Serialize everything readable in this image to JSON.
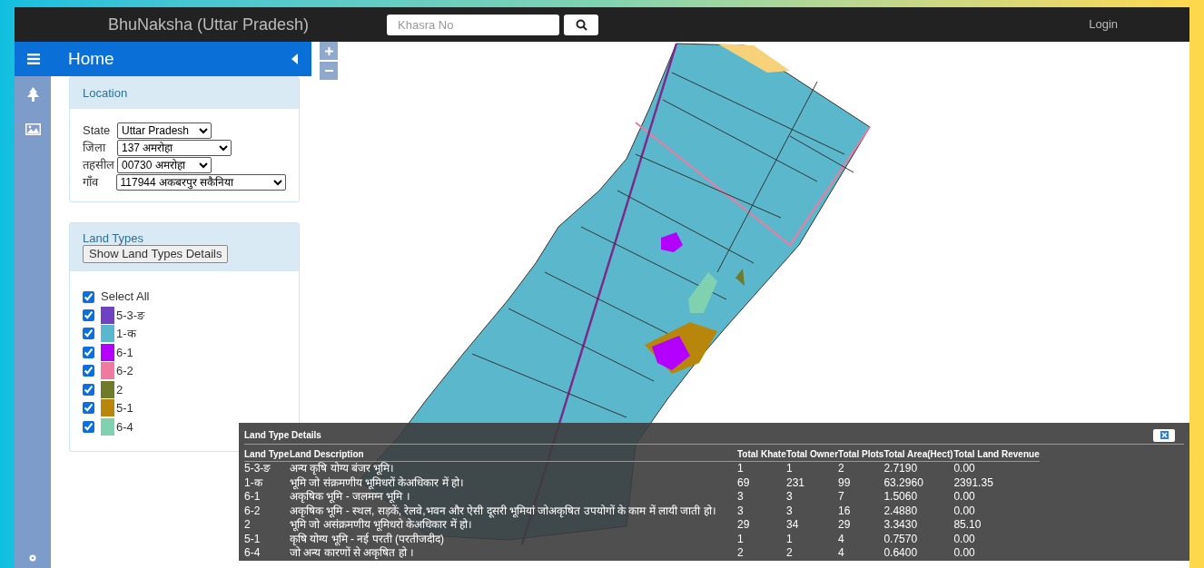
{
  "header": {
    "title": "BhuNaksha (Uttar Pradesh)",
    "search_placeholder": "Khasra No",
    "login": "Login"
  },
  "sidebar": {
    "title": "Home"
  },
  "location": {
    "title": "Location",
    "fields": [
      {
        "label": "State",
        "value": "Uttar Pradesh"
      },
      {
        "label": "जिला",
        "value": "137 अमरोहा"
      },
      {
        "label": "तहसील",
        "value": "00730 अमरोहा"
      },
      {
        "label": "गाँव",
        "value": "117944 अकबरपुर सकैनिया"
      }
    ]
  },
  "land_types": {
    "title": "Land Types",
    "button": "Show Land Types Details",
    "select_all": {
      "label": "Select All",
      "checked": true
    },
    "items": [
      {
        "code": "5-3-ङ",
        "color": "#6f42c1",
        "checked": true
      },
      {
        "code": "1-क",
        "color": "#5bb8cc",
        "checked": true
      },
      {
        "code": "6-1",
        "color": "#b300ff",
        "checked": true
      },
      {
        "code": "6-2",
        "color": "#f07aa0",
        "checked": true
      },
      {
        "code": "2",
        "color": "#6f7a2b",
        "checked": true
      },
      {
        "code": "5-1",
        "color": "#b8860b",
        "checked": true
      },
      {
        "code": "6-4",
        "color": "#7fd1b0",
        "checked": true
      }
    ]
  },
  "details": {
    "title": "Land Type Details",
    "columns": [
      "Land Type",
      "Land Description",
      "Total Khate",
      "Total Owner",
      "Total Plots",
      "Total Area(Hect)",
      "Total Land Revenue"
    ],
    "rows": [
      [
        "5-3-ङ",
        "अन्य कृषि योग्य बंजर भूमि।",
        "1",
        "1",
        "2",
        "2.7190",
        "0.00"
      ],
      [
        "1-क",
        "भूमि जो संक्रमणीय भूमिधरों केअधिकार में हो।",
        "69",
        "231",
        "99",
        "63.2960",
        "2391.35"
      ],
      [
        "6-1",
        "अकृषिक भूमि - जलमग्न भूमि ।",
        "3",
        "3",
        "7",
        "1.5060",
        "0.00"
      ],
      [
        "6-2",
        "अकृषिक भूमि - स्थल, सड़कें, रेलवे,भवन और ऐसी दूसरी भूमियां जोअकृषित उपयोगों के काम में लायी जाती हो।",
        "3",
        "3",
        "16",
        "2.4880",
        "0.00"
      ],
      [
        "2",
        "भूमि जो असंक्रमणीय भूमिधरो केअधिकार में हो।",
        "29",
        "34",
        "29",
        "3.3430",
        "85.10"
      ],
      [
        "5-1",
        "कृषि योग्य भूमि - नई परती (परतीजदीद)",
        "1",
        "1",
        "4",
        "0.7570",
        "0.00"
      ],
      [
        "6-4",
        "जो अन्य कारणों से अकृषित हो ।",
        "2",
        "2",
        "4",
        "0.6400",
        "0.00"
      ]
    ]
  }
}
